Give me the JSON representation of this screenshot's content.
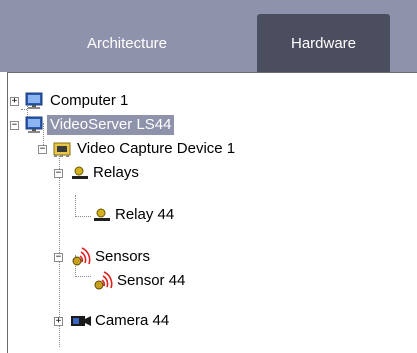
{
  "tabs": [
    {
      "label": "Architecture",
      "active": false
    },
    {
      "label": "Hardware",
      "active": true
    }
  ],
  "tree": {
    "computer": {
      "label": "Computer 1",
      "icon": "monitor-icon",
      "expanded": false
    },
    "videoserver": {
      "label": "VideoServer LS44",
      "icon": "monitor-icon",
      "expanded": true,
      "selected": true
    },
    "capture": {
      "label": "Video Capture Device 1",
      "icon": "capture-card-icon",
      "expanded": true
    },
    "relays": {
      "label": "Relays",
      "icon": "relay-icon",
      "expanded": true
    },
    "relay44": {
      "label": "Relay 44",
      "icon": "relay-icon"
    },
    "sensors": {
      "label": "Sensors",
      "icon": "sensor-icon",
      "expanded": true
    },
    "sensor44": {
      "label": "Sensor 44",
      "icon": "sensor-icon"
    },
    "camera": {
      "label": "Camera 44",
      "icon": "camera-icon",
      "expanded": false
    }
  },
  "colors": {
    "tabbar": "#8e93ab",
    "active_tab": "#4b4e5e",
    "selection": "#8e93ab"
  }
}
